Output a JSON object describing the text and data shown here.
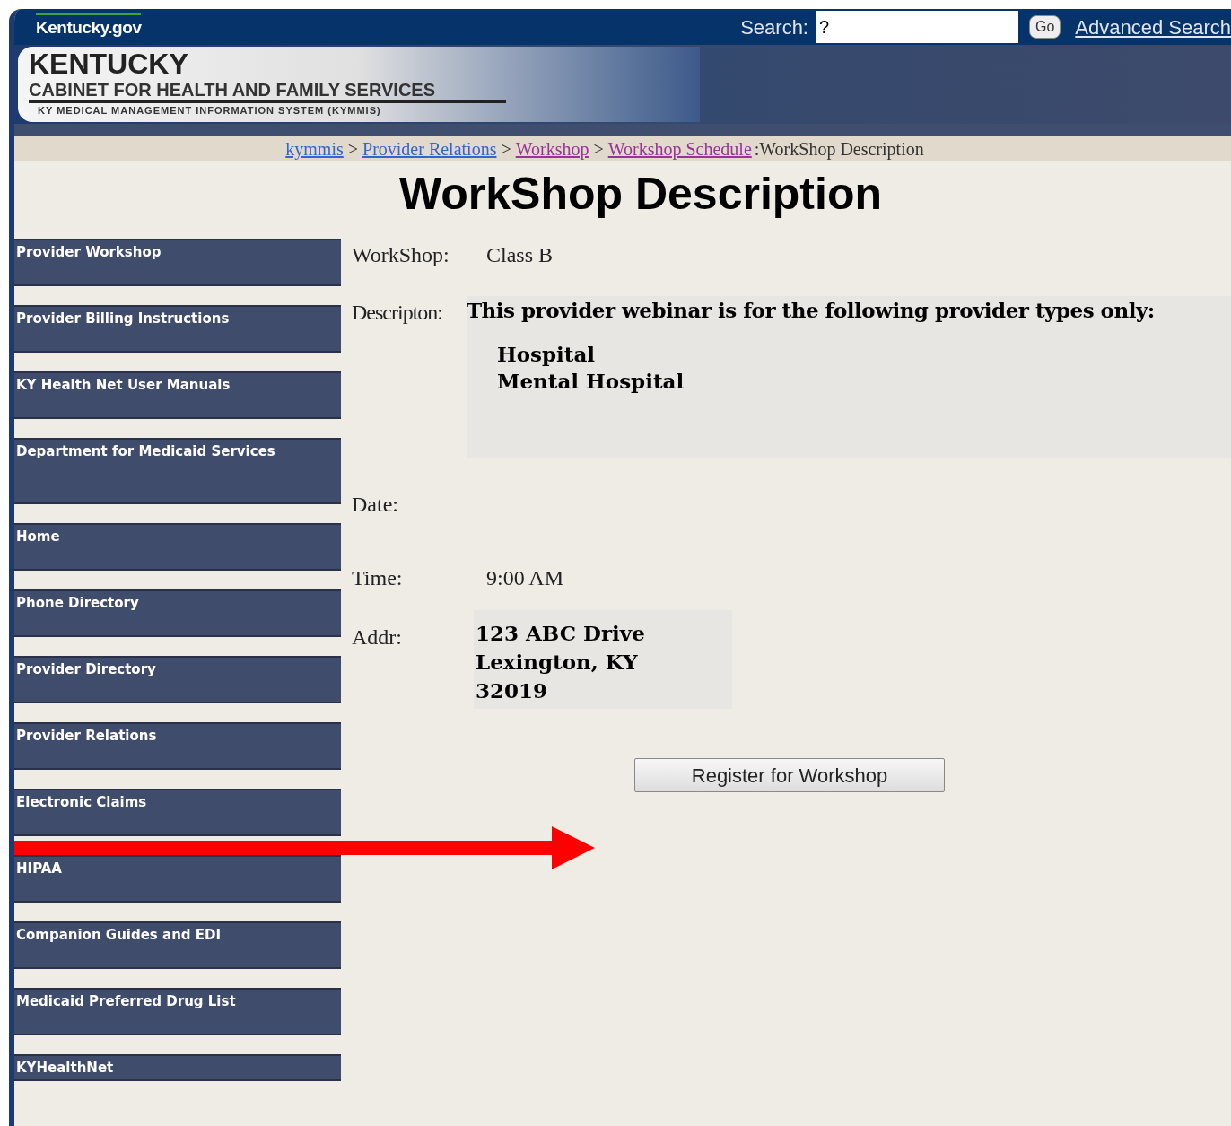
{
  "header": {
    "logo": "Kentucky.gov",
    "search_label": "Search:",
    "search": {
      "value": "?"
    },
    "go_button": "Go",
    "advanced_search": "Advanced Search"
  },
  "banner": {
    "title": "KENTUCKY",
    "subtitle": "CABINET FOR HEALTH AND FAMILY SERVICES",
    "system": "KY MEDICAL MANAGEMENT INFORMATION SYSTEM (KYMMIS)"
  },
  "breadcrumb": {
    "links": [
      {
        "label": "kymmis",
        "color": "#3366cc"
      },
      {
        "label": "Provider Relations",
        "color": "#3366cc"
      },
      {
        "label": "Workshop",
        "color": "#993399"
      },
      {
        "label": "Workshop Schedule",
        "color": "#993399"
      }
    ],
    "separator": ">",
    "current": ":WorkShop Description"
  },
  "page_title": "WorkShop Description",
  "sidebar": {
    "items": [
      {
        "label": "Provider Workshop"
      },
      {
        "label": "Provider Billing Instructions"
      },
      {
        "label": "KY Health Net User Manuals"
      },
      {
        "label": "Department for Medicaid Services",
        "kind": "tall"
      },
      {
        "label": "Home"
      },
      {
        "label": "Phone Directory"
      },
      {
        "label": "Provider Directory"
      },
      {
        "label": "Provider Relations"
      },
      {
        "label": "Electronic Claims"
      },
      {
        "label": "HIPAA"
      },
      {
        "label": "Companion Guides and EDI"
      },
      {
        "label": "Medicaid Preferred Drug List"
      },
      {
        "label": "KYHealthNet",
        "kind": "short"
      }
    ]
  },
  "fields": [
    {
      "kind": "plain",
      "label": "WorkShop:",
      "value": "Class B"
    },
    {
      "kind": "description",
      "label": "Descripton:",
      "value": "This provider webinar is for the following provider types only:",
      "list": [
        "Hospital",
        "Mental Hospital"
      ]
    },
    {
      "kind": "empty",
      "label": "Date:"
    },
    {
      "kind": "plain",
      "label": "Time:",
      "value": "9:00 AM"
    },
    {
      "kind": "address",
      "label": "Addr:",
      "lines": [
        "123 ABC Drive",
        "Lexington, KY",
        "32019"
      ]
    }
  ],
  "register_button": "Register for Workshop"
}
